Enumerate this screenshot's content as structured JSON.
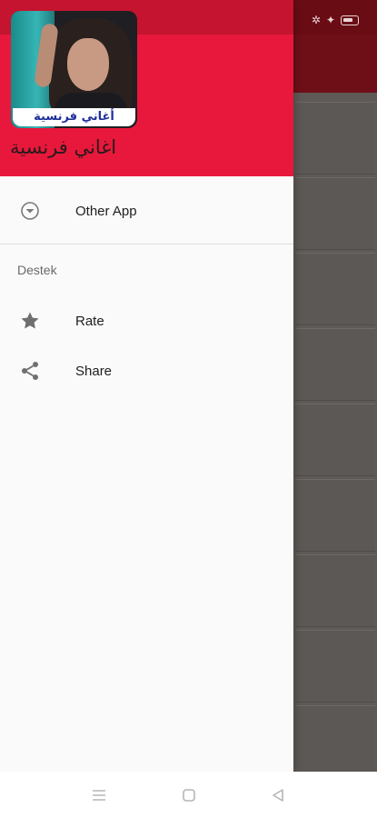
{
  "drawer": {
    "avatar_caption": "أغاني فرنسية",
    "app_title": "اغاني فرنسية",
    "items": [
      {
        "label": "Other App",
        "icon": "chevron-circle-down-icon"
      }
    ],
    "section": {
      "title": "Destek",
      "items": [
        {
          "label": "Rate",
          "icon": "star-icon"
        },
        {
          "label": "Share",
          "icon": "share-icon"
        }
      ]
    }
  },
  "colors": {
    "header": "#e8183c",
    "header_dark": "#c4142f",
    "drawer_bg": "#fafafa",
    "scrim": "#5f5a57"
  },
  "navbar": {
    "buttons": [
      "menu-icon",
      "home-square-icon",
      "back-triangle-icon"
    ]
  }
}
